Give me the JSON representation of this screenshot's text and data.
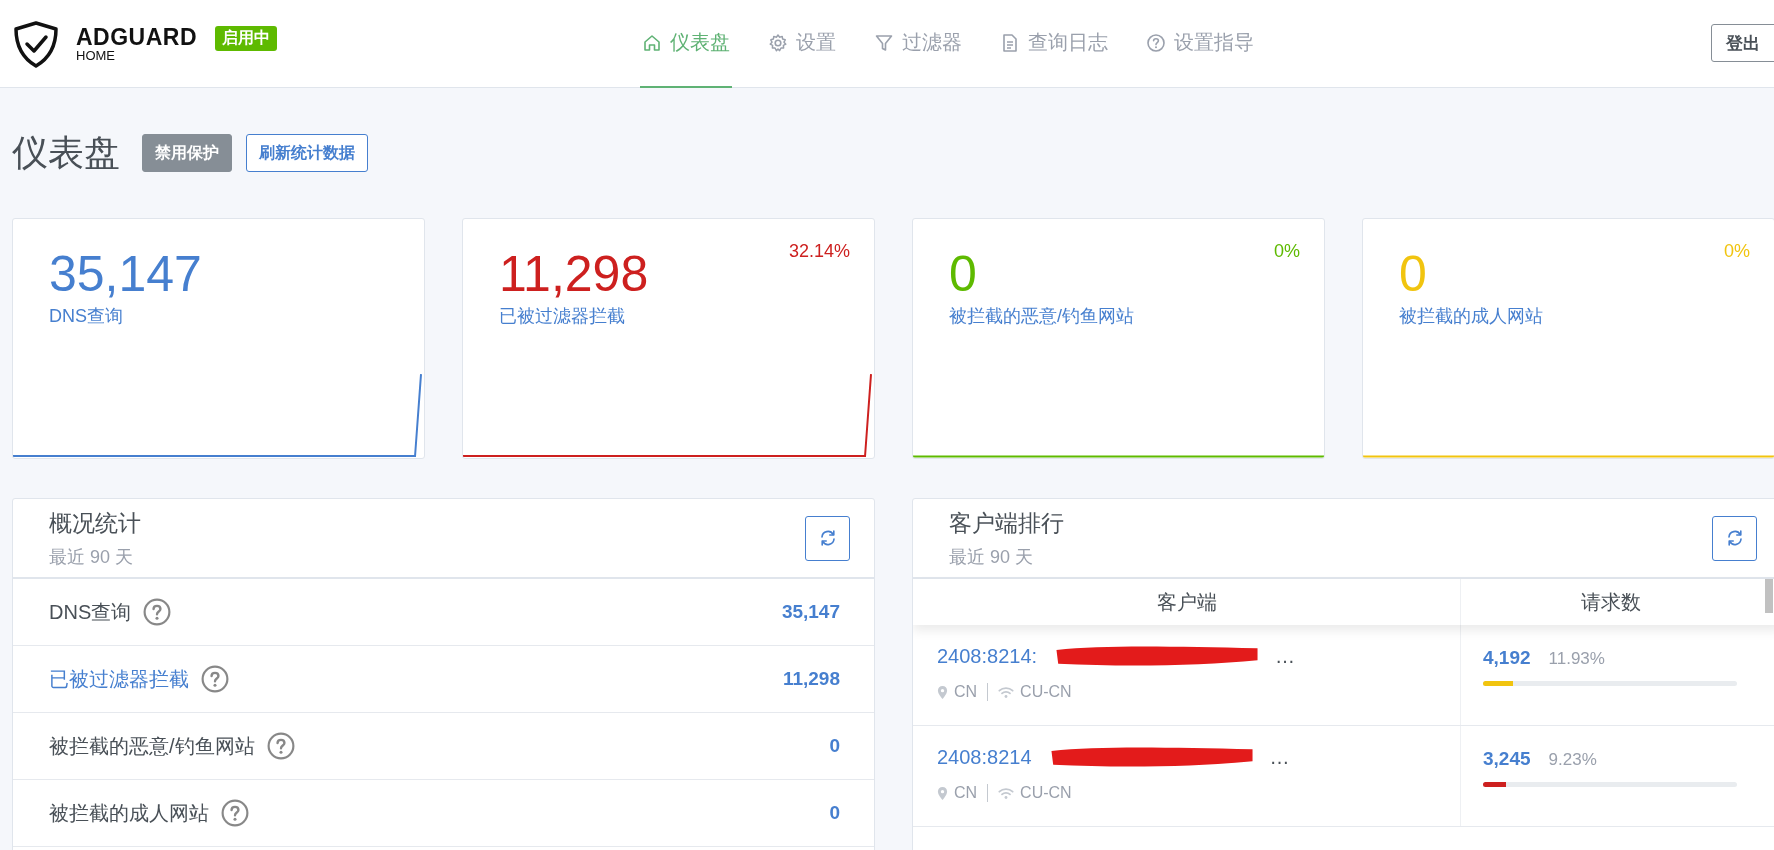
{
  "brand": {
    "name": "ADGUARD",
    "sub": "HOME",
    "status": "启用中"
  },
  "nav": [
    {
      "label": "仪表盘",
      "selected": true
    },
    {
      "label": "设置",
      "selected": false
    },
    {
      "label": "过滤器",
      "selected": false
    },
    {
      "label": "查询日志",
      "selected": false
    },
    {
      "label": "设置指导",
      "selected": false
    }
  ],
  "logout": "登出",
  "page": {
    "title": "仪表盘",
    "buttons": [
      {
        "label": "禁用保护",
        "kind": "secondary"
      },
      {
        "label": "刷新统计数据",
        "kind": "outline"
      }
    ]
  },
  "stat_cards": [
    {
      "value": "35,147",
      "label": "DNS查询",
      "color": "#467fcf"
    },
    {
      "value": "11,298",
      "label": "已被过滤器拦截",
      "percent": "32.14%",
      "color": "#cd201f"
    },
    {
      "value": "0",
      "label": "被拦截的恶意/钓鱼网站",
      "percent": "0%",
      "color": "#5eba00"
    },
    {
      "value": "0",
      "label": "被拦截的成人网站",
      "percent": "0%",
      "color": "#f1c40f"
    }
  ],
  "summary": {
    "title": "概况统计",
    "subtitle": "最近 90 天",
    "rows": [
      {
        "label": "DNS查询",
        "value": "35,147",
        "kind": "text"
      },
      {
        "label": "已被过滤器拦截",
        "value": "11,298",
        "kind": "link"
      },
      {
        "label": "被拦截的恶意/钓鱼网站",
        "value": "0",
        "kind": "text"
      },
      {
        "label": "被拦截的成人网站",
        "value": "0",
        "kind": "text"
      }
    ]
  },
  "clients": {
    "title": "客户端排行",
    "subtitle": "最近 90 天",
    "columns": [
      "客户端",
      "请求数"
    ],
    "rows": [
      {
        "name": "2408:8214:",
        "ellipsis": "…",
        "country": "CN",
        "network": "CU-CN",
        "count": "4,192",
        "percent": "11.93%",
        "level": 0.12,
        "color": "#f1c40f"
      },
      {
        "name": "2408:8214",
        "ellipsis": "…",
        "country": "CN",
        "network": "CU-CN",
        "count": "3,245",
        "percent": "9.23%",
        "level": 0.09,
        "color": "#cd201f"
      }
    ]
  }
}
